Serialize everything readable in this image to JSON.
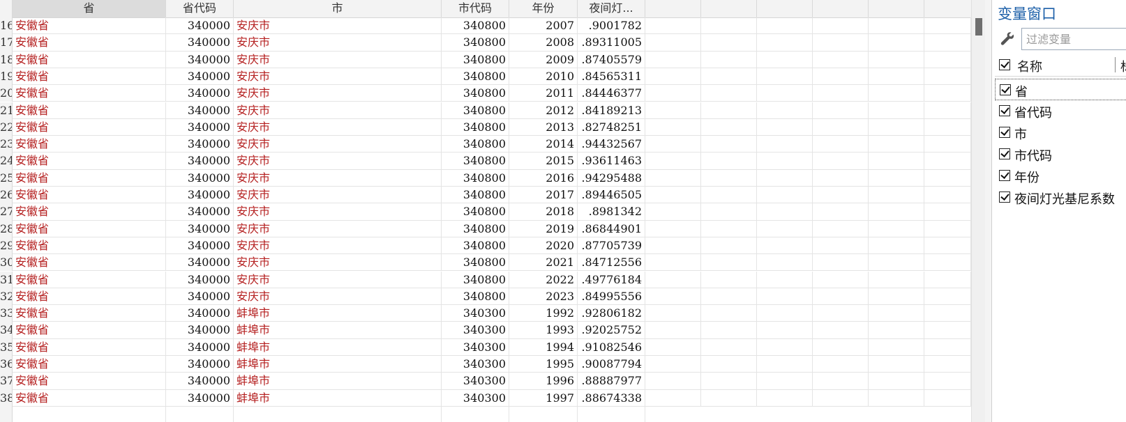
{
  "grid": {
    "columns": [
      "",
      "省",
      "省代码",
      "市",
      "市代码",
      "年份",
      "夜间灯..."
    ],
    "rows": [
      {
        "n": "16",
        "prov": "安徽省",
        "pcode": "340000",
        "city": "安庆市",
        "ccode": "340800",
        "year": "2007",
        "val": ".9001782"
      },
      {
        "n": "17",
        "prov": "安徽省",
        "pcode": "340000",
        "city": "安庆市",
        "ccode": "340800",
        "year": "2008",
        "val": ".89311005"
      },
      {
        "n": "18",
        "prov": "安徽省",
        "pcode": "340000",
        "city": "安庆市",
        "ccode": "340800",
        "year": "2009",
        "val": ".87405579"
      },
      {
        "n": "19",
        "prov": "安徽省",
        "pcode": "340000",
        "city": "安庆市",
        "ccode": "340800",
        "year": "2010",
        "val": ".84565311"
      },
      {
        "n": "20",
        "prov": "安徽省",
        "pcode": "340000",
        "city": "安庆市",
        "ccode": "340800",
        "year": "2011",
        "val": ".84446377"
      },
      {
        "n": "21",
        "prov": "安徽省",
        "pcode": "340000",
        "city": "安庆市",
        "ccode": "340800",
        "year": "2012",
        "val": ".84189213"
      },
      {
        "n": "22",
        "prov": "安徽省",
        "pcode": "340000",
        "city": "安庆市",
        "ccode": "340800",
        "year": "2013",
        "val": ".82748251"
      },
      {
        "n": "23",
        "prov": "安徽省",
        "pcode": "340000",
        "city": "安庆市",
        "ccode": "340800",
        "year": "2014",
        "val": ".94432567"
      },
      {
        "n": "24",
        "prov": "安徽省",
        "pcode": "340000",
        "city": "安庆市",
        "ccode": "340800",
        "year": "2015",
        "val": ".93611463"
      },
      {
        "n": "25",
        "prov": "安徽省",
        "pcode": "340000",
        "city": "安庆市",
        "ccode": "340800",
        "year": "2016",
        "val": ".94295488"
      },
      {
        "n": "26",
        "prov": "安徽省",
        "pcode": "340000",
        "city": "安庆市",
        "ccode": "340800",
        "year": "2017",
        "val": ".89446505"
      },
      {
        "n": "27",
        "prov": "安徽省",
        "pcode": "340000",
        "city": "安庆市",
        "ccode": "340800",
        "year": "2018",
        "val": ".8981342"
      },
      {
        "n": "28",
        "prov": "安徽省",
        "pcode": "340000",
        "city": "安庆市",
        "ccode": "340800",
        "year": "2019",
        "val": ".86844901"
      },
      {
        "n": "29",
        "prov": "安徽省",
        "pcode": "340000",
        "city": "安庆市",
        "ccode": "340800",
        "year": "2020",
        "val": ".87705739"
      },
      {
        "n": "30",
        "prov": "安徽省",
        "pcode": "340000",
        "city": "安庆市",
        "ccode": "340800",
        "year": "2021",
        "val": ".84712556"
      },
      {
        "n": "31",
        "prov": "安徽省",
        "pcode": "340000",
        "city": "安庆市",
        "ccode": "340800",
        "year": "2022",
        "val": ".49776184"
      },
      {
        "n": "32",
        "prov": "安徽省",
        "pcode": "340000",
        "city": "安庆市",
        "ccode": "340800",
        "year": "2023",
        "val": ".84995556"
      },
      {
        "n": "33",
        "prov": "安徽省",
        "pcode": "340000",
        "city": "蚌埠市",
        "ccode": "340300",
        "year": "1992",
        "val": ".92806182"
      },
      {
        "n": "34",
        "prov": "安徽省",
        "pcode": "340000",
        "city": "蚌埠市",
        "ccode": "340300",
        "year": "1993",
        "val": ".92025752"
      },
      {
        "n": "35",
        "prov": "安徽省",
        "pcode": "340000",
        "city": "蚌埠市",
        "ccode": "340300",
        "year": "1994",
        "val": ".91082546"
      },
      {
        "n": "36",
        "prov": "安徽省",
        "pcode": "340000",
        "city": "蚌埠市",
        "ccode": "340300",
        "year": "1995",
        "val": ".90087794"
      },
      {
        "n": "37",
        "prov": "安徽省",
        "pcode": "340000",
        "city": "蚌埠市",
        "ccode": "340300",
        "year": "1996",
        "val": ".88887977"
      },
      {
        "n": "38",
        "prov": "安徽省",
        "pcode": "340000",
        "city": "蚌埠市",
        "ccode": "340300",
        "year": "1997",
        "val": ".88674338"
      }
    ],
    "selected_column": "省"
  },
  "variables_panel": {
    "title": "变量窗口",
    "filter_placeholder": "过滤变量",
    "header_name": "名称",
    "header_label_cut": "标",
    "variables": [
      "省",
      "省代码",
      "市",
      "市代码",
      "年份",
      "夜间灯光基尼系数"
    ],
    "selected_variable": "省"
  },
  "colors": {
    "string_text": "#b41e1e",
    "panel_title": "#1c5fa8"
  }
}
